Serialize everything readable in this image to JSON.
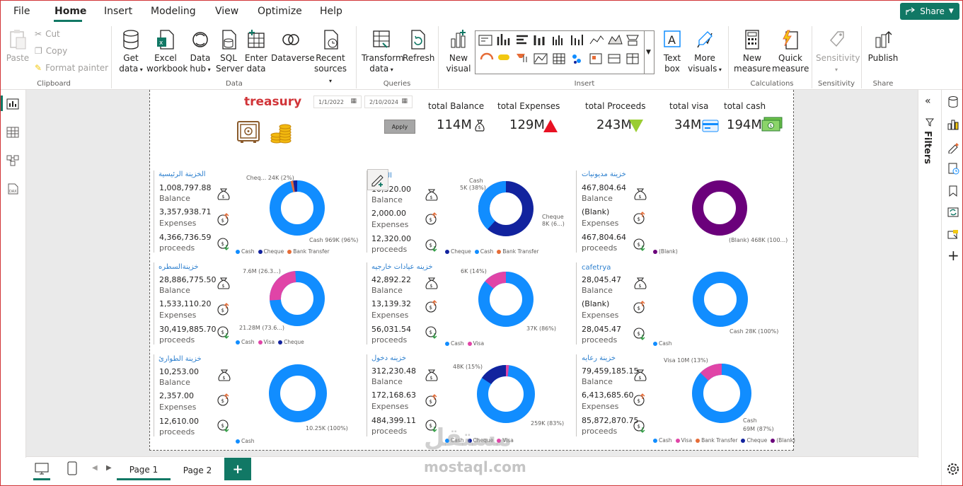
{
  "menu": {
    "items": [
      "File",
      "Home",
      "Insert",
      "Modeling",
      "View",
      "Optimize",
      "Help"
    ],
    "active": "Home",
    "share": "Share"
  },
  "ribbon": {
    "clipboard": {
      "paste": "Paste",
      "cut": "Cut",
      "copy": "Copy",
      "format_painter": "Format painter",
      "label": "Clipboard"
    },
    "data": {
      "get_data": [
        "Get",
        "data"
      ],
      "excel": [
        "Excel",
        "workbook"
      ],
      "hub": [
        "Data",
        "hub"
      ],
      "sql": [
        "SQL",
        "Server"
      ],
      "enter": [
        "Enter",
        "data"
      ],
      "dataverse": "Dataverse",
      "recent": [
        "Recent",
        "sources"
      ],
      "label": "Data"
    },
    "queries": {
      "transform": [
        "Transform",
        "data"
      ],
      "refresh": "Refresh",
      "label": "Queries"
    },
    "insert": {
      "new_visual": [
        "New",
        "visual"
      ],
      "text_box": [
        "Text",
        "box"
      ],
      "more_visuals": [
        "More",
        "visuals"
      ],
      "label": "Insert"
    },
    "calculations": {
      "new_measure": [
        "New",
        "measure"
      ],
      "quick_measure": [
        "Quick",
        "measure"
      ],
      "label": "Calculations"
    },
    "sensitivity": {
      "btn": "Sensitivity",
      "label": "Sensitivity"
    },
    "share": {
      "publish": "Publish",
      "label": "Share"
    }
  },
  "report": {
    "title": "treasury",
    "date_from": "1/1/2022",
    "date_to": "2/10/2024",
    "apply": "Apply",
    "kpis": [
      {
        "label": "total Balance",
        "value": "114M"
      },
      {
        "label": "total Expenses",
        "value": "129M"
      },
      {
        "label": "total Proceeds",
        "value": "243M"
      },
      {
        "label": "total visa",
        "value": "34M"
      },
      {
        "label": "total cash",
        "value": "194M"
      }
    ],
    "panels": [
      {
        "name": "الخزينة الرئيسية",
        "balance": "1,008,797.88",
        "expenses": "3,357,938.71",
        "proceeds": "4,366,736.59",
        "labels": [
          "Cheq... 24K (2%)",
          "Cash 969K (96%)"
        ],
        "legend": [
          "Cash",
          "Cheque",
          "Bank Transfer"
        ]
      },
      {
        "name": "الخزينه",
        "balance": "10,320.00",
        "expenses": "2,000.00",
        "proceeds": "12,320.00",
        "labels": [
          "Cash",
          "5K (38%)",
          "Cheque",
          "8K (6...)"
        ],
        "legend": [
          "Cheque",
          "Cash",
          "Bank Transfer"
        ]
      },
      {
        "name": "خزينة مديونيات",
        "balance": "467,804.64",
        "expenses": "(Blank)",
        "proceeds": "467,804.64",
        "labels": [
          "(Blank) 468K (100...)"
        ],
        "legend": [
          "(Blank)"
        ]
      },
      {
        "name": "خزينةالسطره",
        "balance": "28,886,775.50",
        "expenses": "1,533,110.20",
        "proceeds": "30,419,885.70",
        "labels": [
          "7.6M (26.3...)",
          "21.28M (73.6...)"
        ],
        "legend": [
          "Cash",
          "Visa",
          "Cheque"
        ]
      },
      {
        "name": "خزينه عيادات خارجيه",
        "balance": "42,892.22",
        "expenses": "13,139.32",
        "proceeds": "56,031.54",
        "labels": [
          "6K (14%)",
          "37K (86%)"
        ],
        "legend": [
          "Cash",
          "Visa"
        ]
      },
      {
        "name": "cafetrya",
        "balance": "28,045.47",
        "expenses": "(Blank)",
        "proceeds": "28,045.47",
        "labels": [
          "Cash 28K (100%)"
        ],
        "legend": [
          "Cash"
        ]
      },
      {
        "name": "خزينة الطوارئ",
        "balance": "10,253.00",
        "expenses": "2,357.00",
        "proceeds": "12,610.00",
        "labels": [
          "10.25K (100%)"
        ],
        "legend": [
          "Cash"
        ]
      },
      {
        "name": "خزينه دخول",
        "balance": "312,230.48",
        "expenses": "172,168.63",
        "proceeds": "484,399.11",
        "labels": [
          "48K (15%)",
          "259K (83%)"
        ],
        "legend": [
          "Cash",
          "Cheque",
          "Visa"
        ]
      },
      {
        "name": "خزينة رعايه",
        "balance": "79,459,185.15",
        "expenses": "6,413,685.60",
        "proceeds": "85,872,870.75",
        "labels": [
          "Visa 10M (13%)",
          "Cash",
          "69M (87%)"
        ],
        "legend": [
          "Cash",
          "Visa",
          "Bank Transfer",
          "Cheque",
          "(Blank)"
        ]
      }
    ],
    "row_labels": {
      "balance": "Balance",
      "expenses": "Expenses",
      "proceeds": "proceeds"
    }
  },
  "right_pane": {
    "filters": "Filters"
  },
  "pages": {
    "tabs": [
      "Page 1",
      "Page 2"
    ],
    "add": "+"
  },
  "watermark": {
    "arabic": "مستقل",
    "latin": "mostaql.com"
  },
  "colors": {
    "cash": "#118dff",
    "cheque": "#12239e",
    "bank": "#e66c37",
    "visa": "#e044a7",
    "blank": "#6b007b",
    "accent": "#117865",
    "title": "#d13438"
  }
}
